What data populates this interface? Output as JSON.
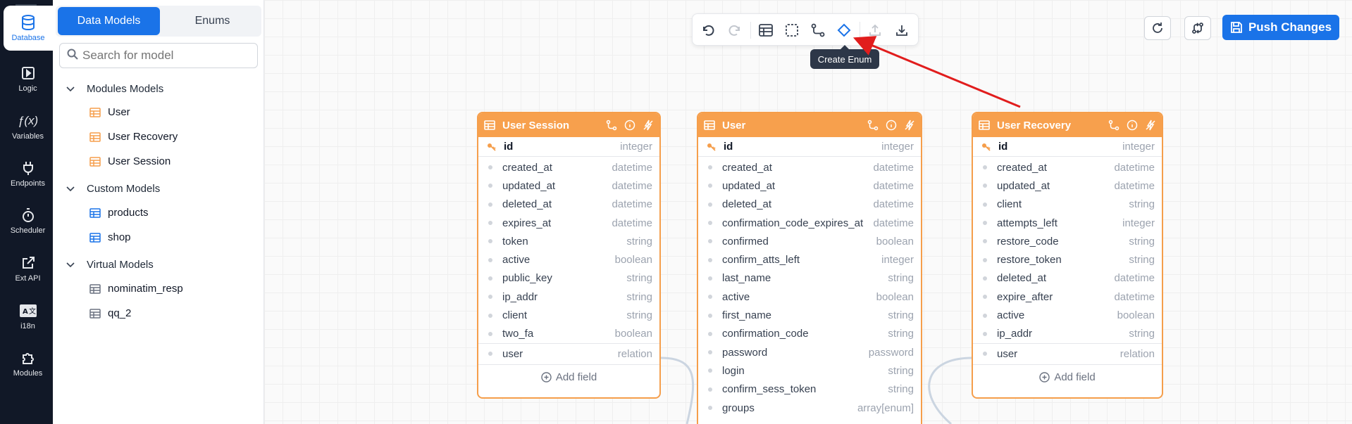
{
  "rail": {
    "items": [
      {
        "label": "Database",
        "icon": "database-icon",
        "active": true
      },
      {
        "label": "Logic",
        "icon": "play-square-icon"
      },
      {
        "label": "Variables",
        "icon": "function-icon"
      },
      {
        "label": "Endpoints",
        "icon": "plug-icon"
      },
      {
        "label": "Scheduler",
        "icon": "stopwatch-icon"
      },
      {
        "label": "Ext API",
        "icon": "external-link-icon"
      },
      {
        "label": "i18n",
        "icon": "translate-icon"
      },
      {
        "label": "Modules",
        "icon": "puzzle-icon"
      }
    ]
  },
  "sidebar": {
    "tabs": [
      "Data Models",
      "Enums"
    ],
    "search_placeholder": "Search for model",
    "groups": [
      {
        "label": "Modules Models",
        "items": [
          "User",
          "User Recovery",
          "User Session"
        ]
      },
      {
        "label": "Custom Models",
        "items": [
          "products",
          "shop"
        ]
      },
      {
        "label": "Virtual Models",
        "items": [
          "nominatim_resp",
          "qq_2"
        ]
      }
    ]
  },
  "toolbar": {
    "buttons": [
      "undo-icon",
      "redo-icon",
      "table-icon",
      "select-icon",
      "relation-icon",
      "enum-icon",
      "upload-icon",
      "download-icon"
    ],
    "tooltip": "Create Enum"
  },
  "header": {
    "push_label": "Push Changes"
  },
  "colors": {
    "accent": "#1a73e8",
    "model_header": "#f7a04d",
    "arrow": "#e11d1d"
  },
  "models": {
    "user_session": {
      "title": "User Session",
      "id": {
        "name": "id",
        "type": "integer"
      },
      "fields": [
        {
          "name": "created_at",
          "type": "datetime"
        },
        {
          "name": "updated_at",
          "type": "datetime"
        },
        {
          "name": "deleted_at",
          "type": "datetime"
        },
        {
          "name": "expires_at",
          "type": "datetime"
        },
        {
          "name": "token",
          "type": "string"
        },
        {
          "name": "active",
          "type": "boolean"
        },
        {
          "name": "public_key",
          "type": "string"
        },
        {
          "name": "ip_addr",
          "type": "string"
        },
        {
          "name": "client",
          "type": "string"
        },
        {
          "name": "two_fa",
          "type": "boolean"
        }
      ],
      "relation": {
        "name": "user",
        "type": "relation"
      },
      "add_field": "Add field"
    },
    "user": {
      "title": "User",
      "id": {
        "name": "id",
        "type": "integer"
      },
      "fields": [
        {
          "name": "created_at",
          "type": "datetime"
        },
        {
          "name": "updated_at",
          "type": "datetime"
        },
        {
          "name": "deleted_at",
          "type": "datetime"
        },
        {
          "name": "confirmation_code_expires_at",
          "type": "datetime"
        },
        {
          "name": "confirmed",
          "type": "boolean"
        },
        {
          "name": "confirm_atts_left",
          "type": "integer"
        },
        {
          "name": "last_name",
          "type": "string"
        },
        {
          "name": "active",
          "type": "boolean"
        },
        {
          "name": "first_name",
          "type": "string"
        },
        {
          "name": "confirmation_code",
          "type": "string"
        },
        {
          "name": "password",
          "type": "password"
        },
        {
          "name": "login",
          "type": "string"
        },
        {
          "name": "confirm_sess_token",
          "type": "string"
        },
        {
          "name": "groups",
          "type": "array[enum]"
        }
      ]
    },
    "user_recovery": {
      "title": "User Recovery",
      "id": {
        "name": "id",
        "type": "integer"
      },
      "fields": [
        {
          "name": "created_at",
          "type": "datetime"
        },
        {
          "name": "updated_at",
          "type": "datetime"
        },
        {
          "name": "client",
          "type": "string"
        },
        {
          "name": "attempts_left",
          "type": "integer"
        },
        {
          "name": "restore_code",
          "type": "string"
        },
        {
          "name": "restore_token",
          "type": "string"
        },
        {
          "name": "deleted_at",
          "type": "datetime"
        },
        {
          "name": "expire_after",
          "type": "datetime"
        },
        {
          "name": "active",
          "type": "boolean"
        },
        {
          "name": "ip_addr",
          "type": "string"
        }
      ],
      "relation": {
        "name": "user",
        "type": "relation"
      },
      "add_field": "Add field"
    }
  }
}
